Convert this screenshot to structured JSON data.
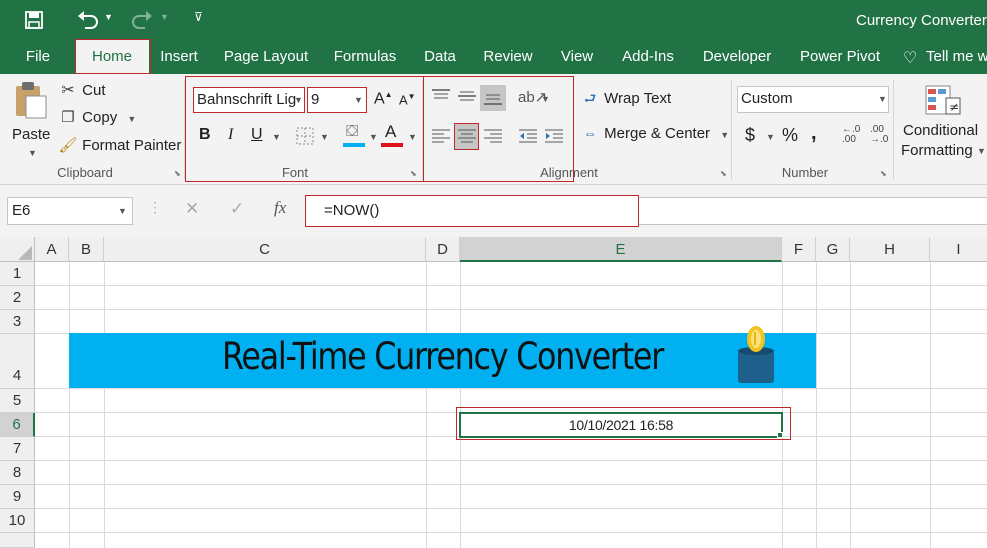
{
  "app": {
    "title": "Currency Converter",
    "theme_color": "#217346"
  },
  "quick_access": {
    "save_icon": "save-icon",
    "undo_icon": "undo-icon",
    "redo_icon": "redo-icon",
    "customize_icon": "customize-qat-icon"
  },
  "tabs": [
    "File",
    "Home",
    "Insert",
    "Page Layout",
    "Formulas",
    "Data",
    "Review",
    "View",
    "Add-Ins",
    "Developer",
    "Power Pivot",
    "Tell me w"
  ],
  "active_tab": "Home",
  "clipboard": {
    "paste": "Paste",
    "cut": "Cut",
    "copy": "Copy",
    "format_painter": "Format Painter",
    "label": "Clipboard"
  },
  "font": {
    "name": "Bahnschrift Lig",
    "size": "9",
    "bold": "B",
    "italic": "I",
    "underline": "U",
    "grow": "A",
    "shrink": "A",
    "font_color_glyph": "A",
    "label": "Font",
    "fill_color": "#00b0f0",
    "font_color": "#e0111b"
  },
  "alignment": {
    "wrap_text": "Wrap Text",
    "merge_center": "Merge & Center",
    "label": "Alignment"
  },
  "number": {
    "format": "Custom",
    "currency": "$",
    "percent": "%",
    "comma": ",",
    "inc_decimal": "←.0\n.00",
    "dec_decimal": ".00\n→.0",
    "label": "Number"
  },
  "styles": {
    "conditional_line1": "Conditional",
    "conditional_line2": "Formatting"
  },
  "formula_bar": {
    "name_box": "E6",
    "cancel": "✕",
    "enter": "✓",
    "fx": "fx",
    "formula": "=NOW()"
  },
  "columns": [
    "A",
    "B",
    "C",
    "D",
    "E",
    "F",
    "G",
    "H",
    "I"
  ],
  "rows": [
    "1",
    "2",
    "3",
    "4",
    "5",
    "6",
    "7",
    "8",
    "9",
    "10"
  ],
  "banner": {
    "title": "Real-Time Currency Converter",
    "color": "#00b0f0"
  },
  "cells": {
    "E6": "10/10/2021 16:58"
  },
  "highlight_color": "#c0282d"
}
